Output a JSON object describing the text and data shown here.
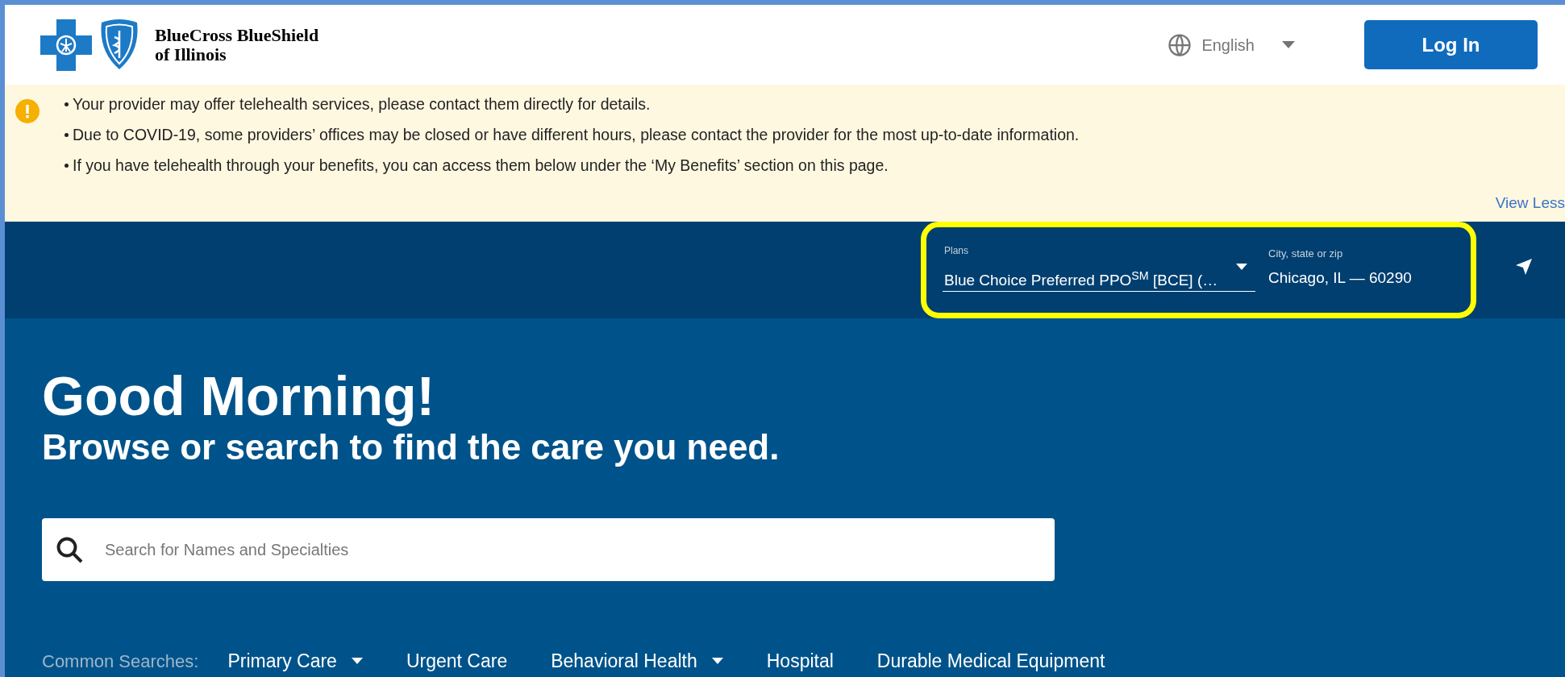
{
  "header": {
    "logo_lines": [
      "BlueCross BlueShield",
      "of Illinois"
    ],
    "language": "English",
    "login": "Log In"
  },
  "notice": {
    "items": [
      "Your provider may offer telehealth services, please contact them directly for details.",
      "Due to COVID-19, some providers’ offices may be closed or have different hours, please contact the provider for the most up-to-date information.",
      "If you have telehealth through your benefits, you can access them below under the ‘My Benefits’ section on this page."
    ],
    "toggle": "View Less"
  },
  "filters": {
    "plan": {
      "label": "Plans",
      "value": "Blue Choice Preferred PPO$^{SM}$ [BCE] (…"
    },
    "location": {
      "label": "City, state or zip",
      "value": "Chicago, IL — 60290"
    },
    "highlighted": true
  },
  "hero": {
    "greeting": "Good Morning!",
    "subtitle": "Browse or search to find the care you need.",
    "search": {
      "placeholder": "Search for Names and Specialties"
    }
  },
  "common_searches": {
    "label": "Common Searches:",
    "items": [
      {
        "label": "Primary Care",
        "has_menu": true
      },
      {
        "label": "Urgent Care",
        "has_menu": false
      },
      {
        "label": "Behavioral Health",
        "has_menu": true
      },
      {
        "label": "Hospital",
        "has_menu": false
      },
      {
        "label": "Durable Medical Equipment",
        "has_menu": false
      }
    ]
  }
}
